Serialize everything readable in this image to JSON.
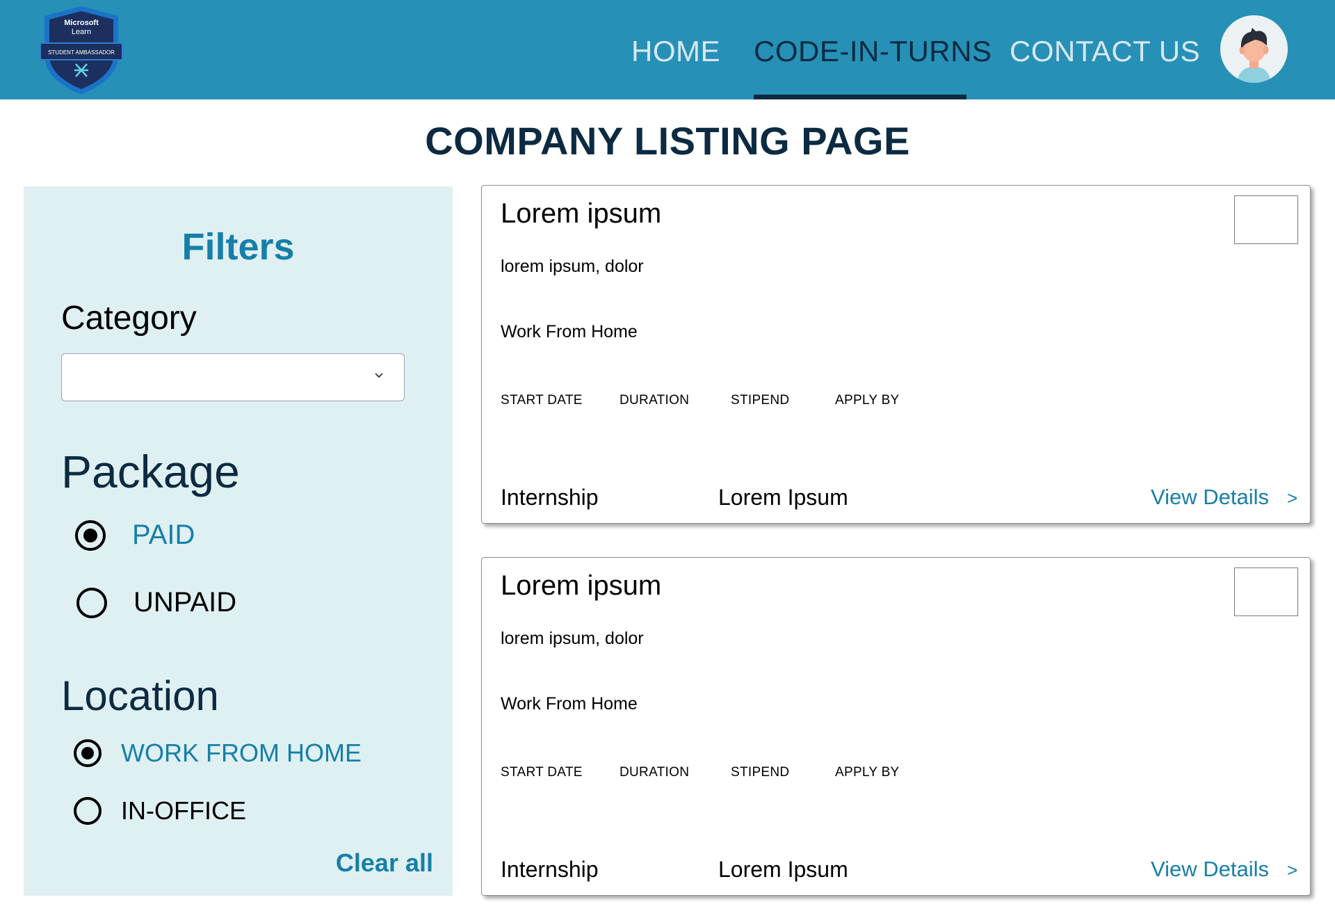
{
  "header": {
    "logo": {
      "line1": "Microsoft",
      "line2": "Learn",
      "ribbon": "STUDENT AMBASSADOR",
      "icon": "student-ambassador-badge"
    },
    "nav": [
      "HOME",
      "CODE-IN-TURNS",
      "CONTACT US"
    ],
    "active_nav": "CODE-IN-TURNS",
    "avatar_icon": "user-avatar"
  },
  "page_title": "COMPANY LISTING PAGE",
  "filters": {
    "title": "Filters",
    "category_label": "Category",
    "category_value": "",
    "package_label": "Package",
    "package_options": [
      "PAID",
      "UNPAID"
    ],
    "package_selected": "PAID",
    "location_label": "Location",
    "location_options": [
      "WORK FROM HOME",
      "IN-OFFICE"
    ],
    "location_selected": "WORK FROM HOME",
    "clear_all": "Clear all"
  },
  "listings": [
    {
      "title": "Lorem ipsum",
      "company": "lorem ipsum, dolor",
      "location": "Work From Home",
      "meta": [
        "START DATE",
        "DURATION",
        "STIPEND",
        "APPLY BY"
      ],
      "type": "Internship",
      "org": "Lorem Ipsum",
      "action": "View Details",
      "action_icon": ">"
    },
    {
      "title": "Lorem ipsum",
      "company": "lorem ipsum, dolor",
      "location": "Work From Home",
      "meta": [
        "START DATE",
        "DURATION",
        "STIPEND",
        "APPLY BY"
      ],
      "type": "Internship",
      "org": "Lorem Ipsum",
      "action": "View Details",
      "action_icon": ">"
    }
  ],
  "colors": {
    "header_bg": "#2790b7",
    "nav_active": "#0c2b42",
    "nav_inactive": "#d8e8ef",
    "accent": "#167fa8",
    "panel_bg": "#dff0f2"
  }
}
